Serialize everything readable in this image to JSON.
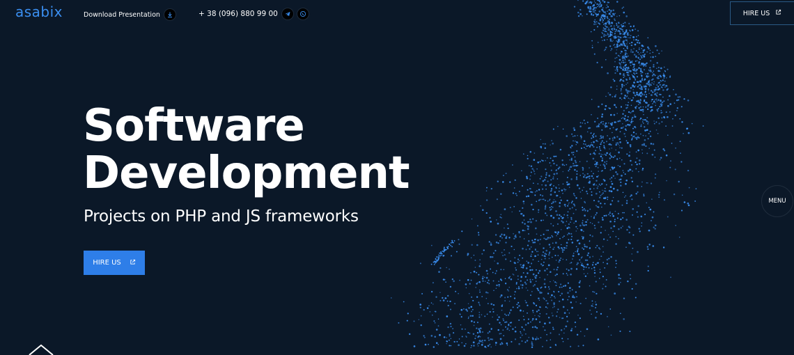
{
  "header": {
    "logo_text": "asabix",
    "download_label": "Download Presentation",
    "phone": "+ 38 (096) 880 99 00",
    "hire_label": "HIRE US"
  },
  "hero": {
    "title_line1": "Software",
    "title_line2": "Development",
    "subtitle": "Projects on PHP and JS frameworks",
    "cta_label": "HIRE US"
  },
  "menu_label": "MENU",
  "colors": {
    "background": "#0b1828",
    "accent": "#2e7ee8",
    "particles": "#3a8ef0"
  },
  "icons": {
    "download": "download-icon",
    "telegram": "telegram-icon",
    "viber": "viber-icon",
    "external": "external-link-icon"
  }
}
